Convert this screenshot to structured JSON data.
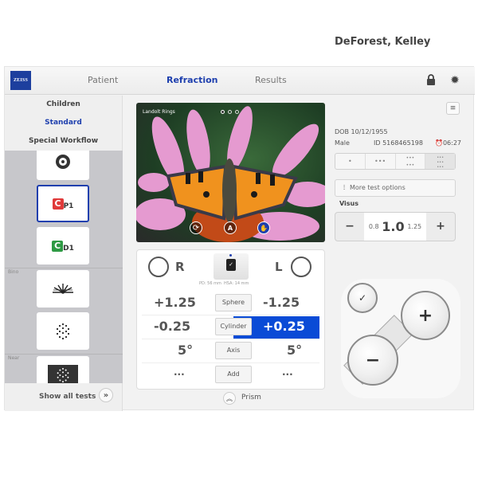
{
  "header": {
    "logo": "ZEISS",
    "tabs": [
      {
        "label": "Patient",
        "active": false
      },
      {
        "label": "Refraction",
        "active": true
      },
      {
        "label": "Results",
        "active": false
      }
    ],
    "icons": [
      "lock-icon",
      "gear-icon"
    ]
  },
  "sidebar": {
    "segments": [
      {
        "label": "Children",
        "active": false
      },
      {
        "label": "Standard",
        "active": true
      },
      {
        "label": "Special Workflow",
        "active": false
      }
    ],
    "groups": [
      "Bino",
      "Near"
    ],
    "tiles": [
      {
        "name": "ring-target",
        "label": ""
      },
      {
        "name": "landolt-p1",
        "label": "P1",
        "color": "#e03a3a",
        "selected": true
      },
      {
        "name": "landolt-d1",
        "label": "D1",
        "color": "#2e9a44"
      },
      {
        "name": "sunburst",
        "label": ""
      },
      {
        "name": "dot-pattern",
        "label": ""
      },
      {
        "name": "dot-pattern-dark",
        "label": ""
      }
    ],
    "show_all": "Show all tests"
  },
  "photo": {
    "label": "Landolt Rings",
    "page_dots": 3
  },
  "refraction": {
    "right_label": "R",
    "left_label": "L",
    "pd": "PD: 56 mm",
    "hsa": "HSA: 14 mm",
    "rows": [
      {
        "param": "Sphere",
        "right": "+1.25",
        "left": "-1.25"
      },
      {
        "param": "Cylinder",
        "right": "-0.25",
        "left": "+0.25",
        "active_side": "left"
      },
      {
        "param": "Axis",
        "right": "5°",
        "left": "5°"
      },
      {
        "param": "Add",
        "right": "...",
        "left": "..."
      }
    ],
    "prism": "Prism"
  },
  "patient": {
    "name": "DeForest, Kelley",
    "dob": "DOB 10/12/1955",
    "sex": "Male",
    "id": "ID 5168465198",
    "time": "06:27"
  },
  "more_options": "More test options",
  "visus": {
    "label": "Visus",
    "prev": "0.8",
    "current": "1.0",
    "next": "1.25",
    "minus": "−",
    "plus": "+"
  },
  "pad": {
    "minus": "−",
    "plus": "+",
    "confirm": "✓"
  },
  "accent": "#1e3fae",
  "highlight": "#0a4bd6"
}
